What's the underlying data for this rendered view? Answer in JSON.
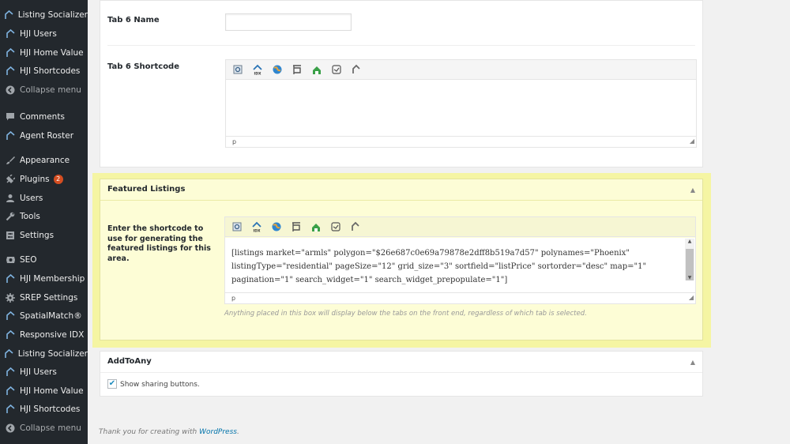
{
  "sidebar": {
    "items": [
      {
        "label": "Listing Socializer",
        "icon": "house-icon"
      },
      {
        "label": "HJI Users",
        "icon": "house-icon"
      },
      {
        "label": "HJI Home Value",
        "icon": "house-icon"
      },
      {
        "label": "HJI Shortcodes",
        "icon": "house-icon"
      },
      {
        "label": "Collapse menu",
        "icon": "collapse-icon"
      },
      {
        "label": "Comments",
        "icon": "comment-icon"
      },
      {
        "label": "Agent Roster",
        "icon": "house-icon"
      },
      {
        "label": "Appearance",
        "icon": "brush-icon"
      },
      {
        "label": "Plugins",
        "icon": "plugin-icon",
        "badge": "2"
      },
      {
        "label": "Users",
        "icon": "user-icon"
      },
      {
        "label": "Tools",
        "icon": "wrench-icon"
      },
      {
        "label": "Settings",
        "icon": "settings-icon"
      },
      {
        "label": "SEO",
        "icon": "seo-icon"
      },
      {
        "label": "HJI Membership",
        "icon": "house-icon"
      },
      {
        "label": "SREP Settings",
        "icon": "gear-icon"
      },
      {
        "label": "SpatialMatch®",
        "icon": "house-icon"
      },
      {
        "label": "Responsive IDX",
        "icon": "house-icon"
      },
      {
        "label": "Listing Socializer",
        "icon": "house-icon"
      },
      {
        "label": "HJI Users",
        "icon": "house-icon"
      },
      {
        "label": "HJI Home Value",
        "icon": "house-icon"
      },
      {
        "label": "HJI Shortcodes",
        "icon": "house-icon"
      },
      {
        "label": "Collapse menu",
        "icon": "collapse-icon"
      }
    ]
  },
  "tab6": {
    "name_label": "Tab 6 Name",
    "name_value": "",
    "shortcode_label": "Tab 6 Shortcode",
    "shortcode_value": "",
    "status_path": "p"
  },
  "featured": {
    "title": "Featured Listings",
    "instruction": "Enter the shortcode to use for generating the featured listings for this area.",
    "shortcode_lines": [
      "[listings market=\"armls\" polygon=\"$26e687c0e69a79878e2dff8b519a7d57\" polynames=\"Phoenix\"",
      "listingType=\"residential\" pageSize=\"12\" grid_size=\"3\" sortfield=\"listPrice\" sortorder=\"desc\" map=\"1\"",
      "pagination=\"1\" search_widget=\"1\" search_widget_prepopulate=\"1\"]"
    ],
    "status_path": "p",
    "hint": "Anything placed in this box will display below the tabs on the front end, regardless of which tab is selected."
  },
  "addtoany": {
    "title": "AddToAny",
    "checkbox_label": "Show sharing buttons.",
    "checked": true
  },
  "footer": {
    "text": "Thank you for creating with",
    "link": "WordPress",
    "suffix": "."
  },
  "toolbar_icons": [
    "map-search-icon",
    "idx-home-icon",
    "globe-icon",
    "listing-board-icon",
    "agent-icon",
    "widget-icon",
    "house-arrow-icon"
  ],
  "colors": {
    "sidebar_bg": "#23282d",
    "highlight": "#f5f5a3",
    "badge": "#d54e21",
    "link": "#0073aa"
  }
}
